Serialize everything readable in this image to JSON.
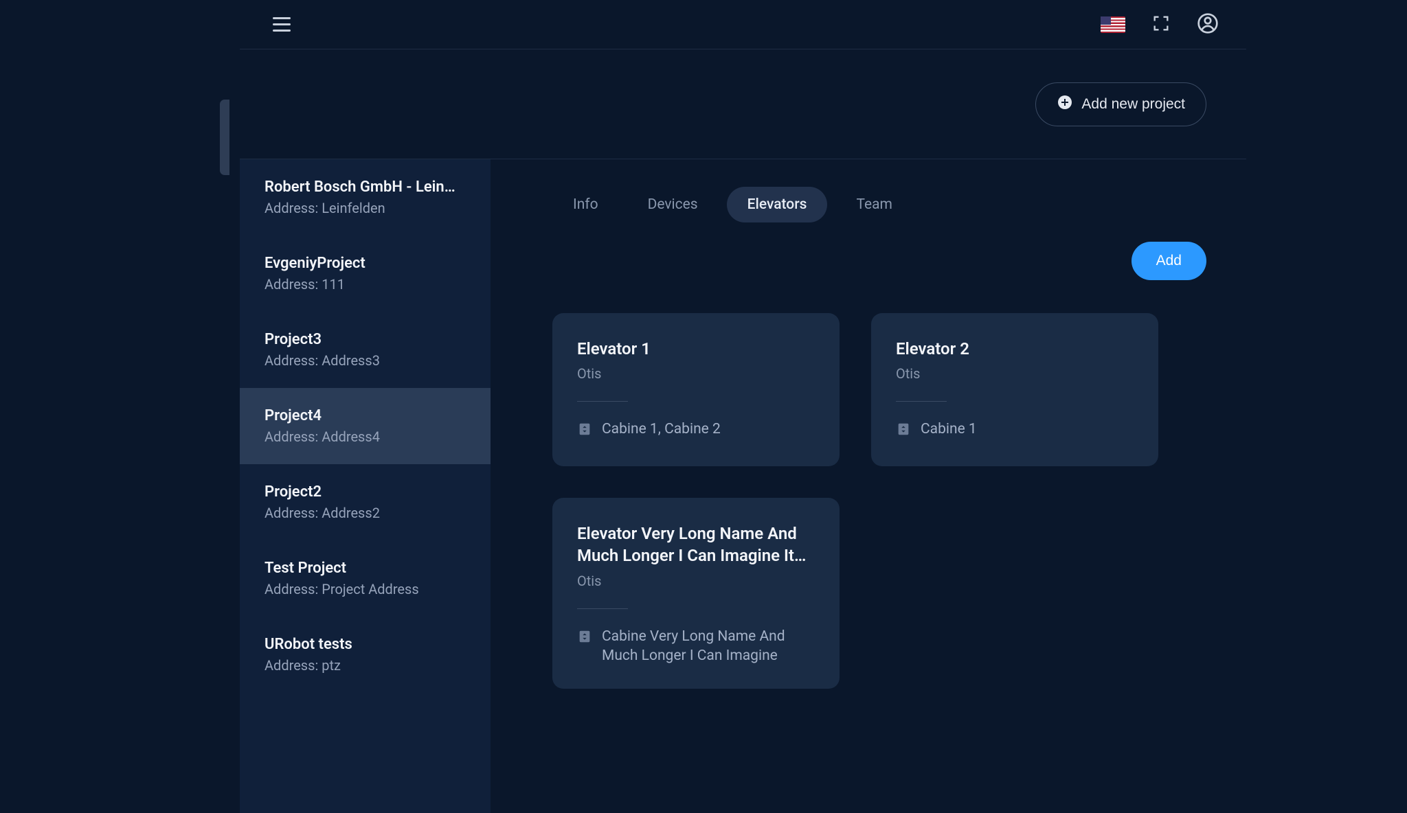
{
  "header": {
    "add_project_label": "Add new project"
  },
  "sidebar": {
    "address_prefix": "Address: ",
    "items": [
      {
        "name": "Robert Bosch GmbH - Lein…",
        "address": "Leinfelden"
      },
      {
        "name": "EvgeniyProject",
        "address": "111"
      },
      {
        "name": "Project3",
        "address": "Address3"
      },
      {
        "name": "Project4",
        "address": "Address4"
      },
      {
        "name": "Project2",
        "address": "Address2"
      },
      {
        "name": "Test Project",
        "address": "Project Address"
      },
      {
        "name": "URobot tests",
        "address": "ptz"
      }
    ],
    "selected_index": 3
  },
  "tabs": {
    "items": [
      "Info",
      "Devices",
      "Elevators",
      "Team"
    ],
    "active_index": 2
  },
  "actions": {
    "add_label": "Add"
  },
  "elevators": [
    {
      "name": "Elevator 1",
      "vendor": "Otis",
      "cabins": "Cabine 1, Cabine 2"
    },
    {
      "name": "Elevator 2",
      "vendor": "Otis",
      "cabins": "Cabine 1"
    },
    {
      "name": "Elevator Very Long Name And Much Longer I Can Imagine It Being",
      "vendor": "Otis",
      "cabins": "Cabine Very Long Name And Much Longer I Can Imagine"
    }
  ]
}
